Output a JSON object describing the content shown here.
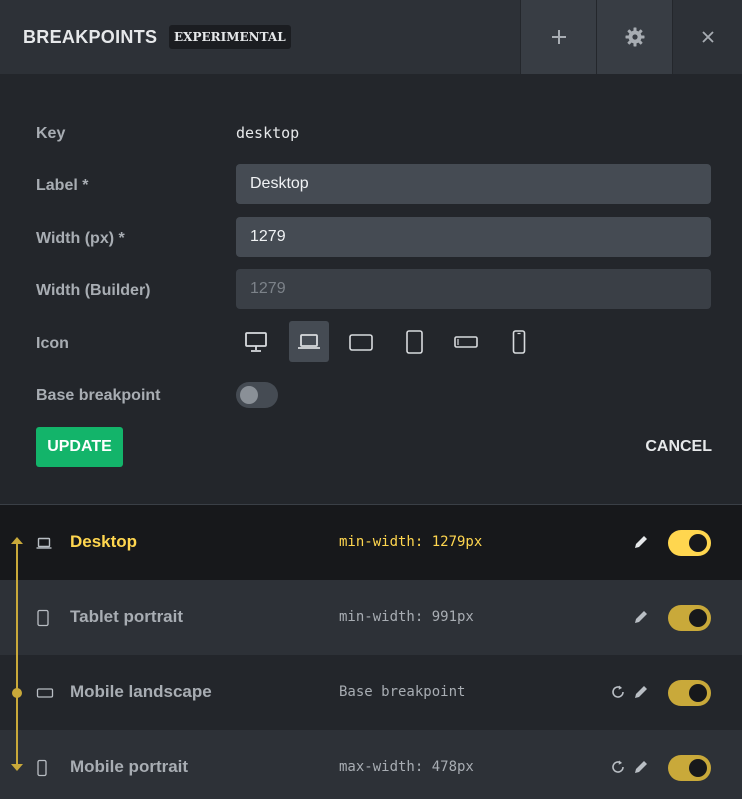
{
  "header": {
    "title": "BREAKPOINTS",
    "badge": "EXPERIMENTAL",
    "add_icon": "plus-icon",
    "settings_icon": "gear-icon",
    "close_icon": "close-icon"
  },
  "form": {
    "key_label": "Key",
    "key_value": "desktop",
    "label_label": "Label *",
    "label_value": "Desktop",
    "width_label": "Width (px) *",
    "width_value": "1279",
    "width_builder_label": "Width (Builder)",
    "width_builder_placeholder": "1279",
    "icon_label": "Icon",
    "icon_options": [
      "desktop-icon",
      "laptop-icon",
      "tablet-landscape-icon",
      "tablet-portrait-icon",
      "mobile-landscape-icon",
      "mobile-portrait-icon"
    ],
    "selected_icon": "laptop-icon",
    "base_label": "Base breakpoint",
    "base_enabled": false,
    "update_label": "UPDATE",
    "cancel_label": "CANCEL"
  },
  "breakpoints": [
    {
      "name": "Desktop",
      "query": "min-width: 1279px",
      "icon": "laptop-icon",
      "active": true,
      "enabled": true,
      "resettable": false
    },
    {
      "name": "Tablet portrait",
      "query": "min-width: 991px",
      "icon": "tablet-portrait-icon",
      "active": false,
      "enabled": true,
      "resettable": false
    },
    {
      "name": "Mobile landscape",
      "query": "Base breakpoint",
      "icon": "mobile-landscape-icon",
      "active": false,
      "enabled": true,
      "resettable": true
    },
    {
      "name": "Mobile portrait",
      "query": "max-width: 478px",
      "icon": "mobile-portrait-icon",
      "active": false,
      "enabled": true,
      "resettable": true
    }
  ],
  "colors": {
    "accent": "#ffd64f",
    "accent_muted": "#c9a93a",
    "success": "#13b46a",
    "panel": "#23262b",
    "header": "#2d3137"
  }
}
